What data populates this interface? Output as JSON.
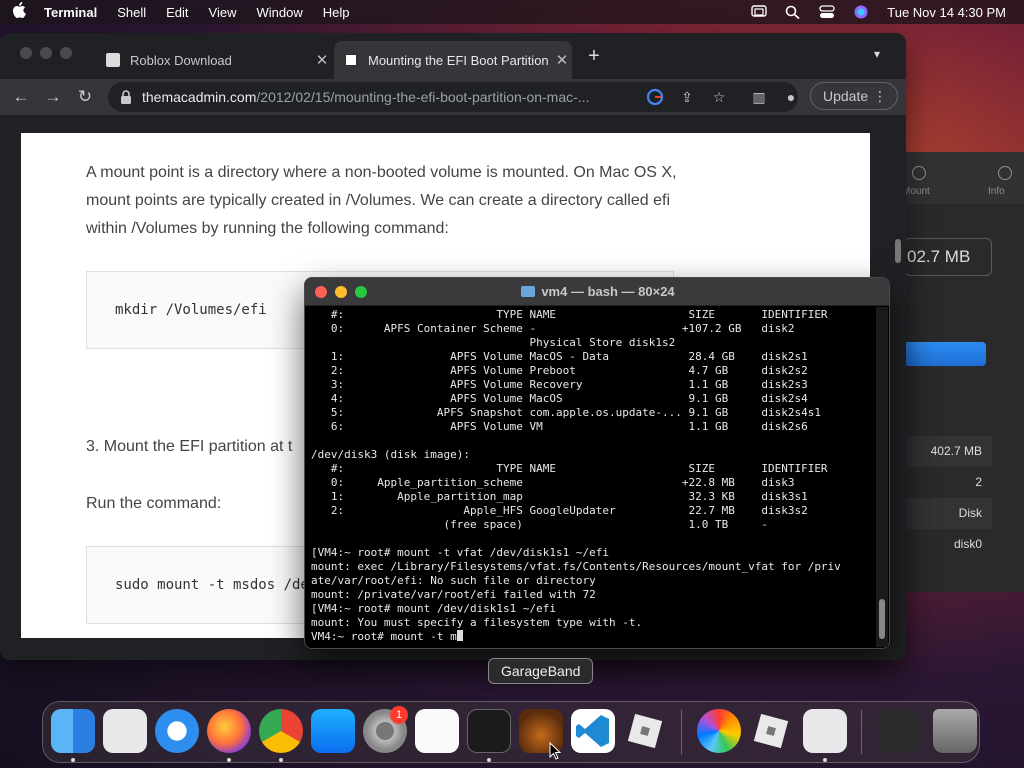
{
  "menubar": {
    "app_name": "Terminal",
    "items": [
      "Shell",
      "Edit",
      "View",
      "Window",
      "Help"
    ],
    "clock": "Tue Nov 14  4:30 PM"
  },
  "disk_panel": {
    "tool_mount": "Mount",
    "tool_info": "Info",
    "size_display": "02.7 MB",
    "rows": [
      "402.7 MB",
      "2",
      "Disk",
      "disk0"
    ]
  },
  "browser": {
    "tabs": [
      {
        "title": "Roblox Download",
        "active": false
      },
      {
        "title": "Mounting the EFI Boot Partition",
        "active": true
      }
    ],
    "url_host": "themacadmin.com",
    "url_path": "/2012/02/15/mounting-the-efi-boot-partition-on-mac-...",
    "update_label": "Update",
    "page": {
      "paragraph": "A mount point is a directory where a non-booted volume is mounted.  On Mac OS X, mount points are typically created in /Volumes.  We can create a directory called efi within /Volumes by running the following command:",
      "code1": "mkdir /Volumes/efi",
      "step3": "3. Mount the EFI partition at t",
      "run_command": "Run the command:",
      "code2": "sudo mount -t msdos /dev"
    }
  },
  "terminal": {
    "title": "vm4 — bash — 80×24",
    "lines": [
      "   #:                       TYPE NAME                    SIZE       IDENTIFIER",
      "   0:      APFS Container Scheme -                      +107.2 GB   disk2",
      "                                 Physical Store disk1s2",
      "   1:                APFS Volume MacOS - Data            28.4 GB    disk2s1",
      "   2:                APFS Volume Preboot                 4.7 GB     disk2s2",
      "   3:                APFS Volume Recovery                1.1 GB     disk2s3",
      "   4:                APFS Volume MacOS                   9.1 GB     disk2s4",
      "   5:              APFS Snapshot com.apple.os.update-... 9.1 GB     disk2s4s1",
      "   6:                APFS Volume VM                      1.1 GB     disk2s6",
      "",
      "/dev/disk3 (disk image):",
      "   #:                       TYPE NAME                    SIZE       IDENTIFIER",
      "   0:     Apple_partition_scheme                        +22.8 MB    disk3",
      "   1:        Apple_partition_map                         32.3 KB    disk3s1",
      "   2:                  Apple_HFS GoogleUpdater           22.7 MB    disk3s2",
      "                    (free space)                         1.0 TB     -",
      "",
      "[VM4:~ root# mount -t vfat /dev/disk1s1 ~/efi",
      "mount: exec /Library/Filesystems/vfat.fs/Contents/Resources/mount_vfat for /priv",
      "ate/var/root/efi: No such file or directory",
      "mount: /private/var/root/efi failed with 72",
      "[VM4:~ root# mount /dev/disk1s1 ~/efi",
      "mount: You must specify a filesystem type with -t."
    ],
    "prompt": "VM4:~ root# mount -t m"
  },
  "tooltip": "GarageBand",
  "dock": {
    "items": [
      "Finder",
      "Launchpad",
      "Safari",
      "Firefox",
      "Google Chrome",
      "App Store",
      "System Preferences",
      "TextEdit",
      "Terminal",
      "GarageBand",
      "Visual Studio Code",
      "Roblox",
      "Photos",
      "Roblox Player",
      "Disk Utility",
      "Window",
      "Trash"
    ],
    "settings_badge": "1"
  },
  "colors": {
    "accent": "#2d8cf0",
    "terminal_bg": "#000000",
    "browser_bg": "#202124"
  }
}
